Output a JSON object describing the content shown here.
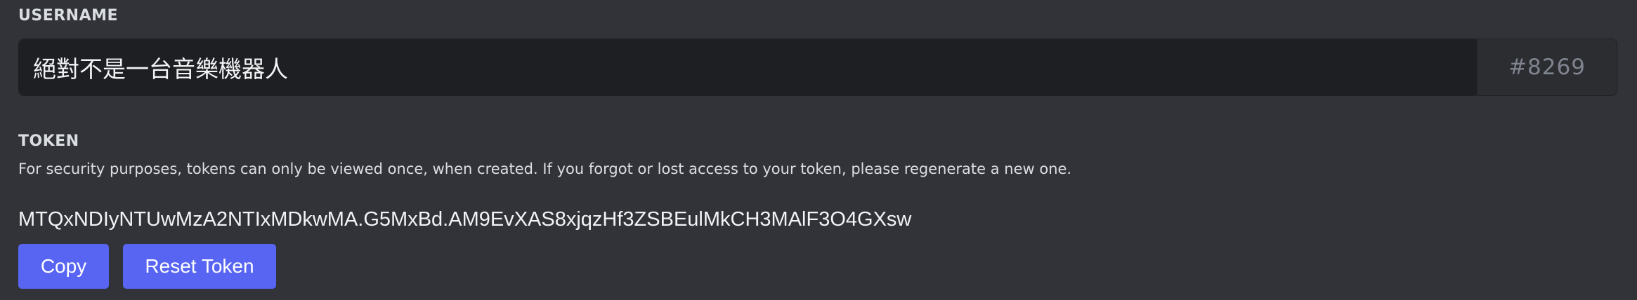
{
  "username": {
    "label": "USERNAME",
    "value": "絕對不是一台音樂機器人",
    "discriminator": "#8269"
  },
  "token": {
    "label": "TOKEN",
    "help_text": "For security purposes, tokens can only be viewed once, when created. If you forgot or lost access to your token, please regenerate a new one.",
    "value": "MTQxNDIyNTUwMzA2NTIxMDkwMA.G5MxBd.AM9EvXAS8xjqzHf3ZSBEulMkCH3MAlF3O4GXsw"
  },
  "buttons": {
    "copy_label": "Copy",
    "reset_label": "Reset Token"
  },
  "colors": {
    "background": "#313338",
    "input_background": "#1e1f22",
    "accent": "#5865f2"
  }
}
